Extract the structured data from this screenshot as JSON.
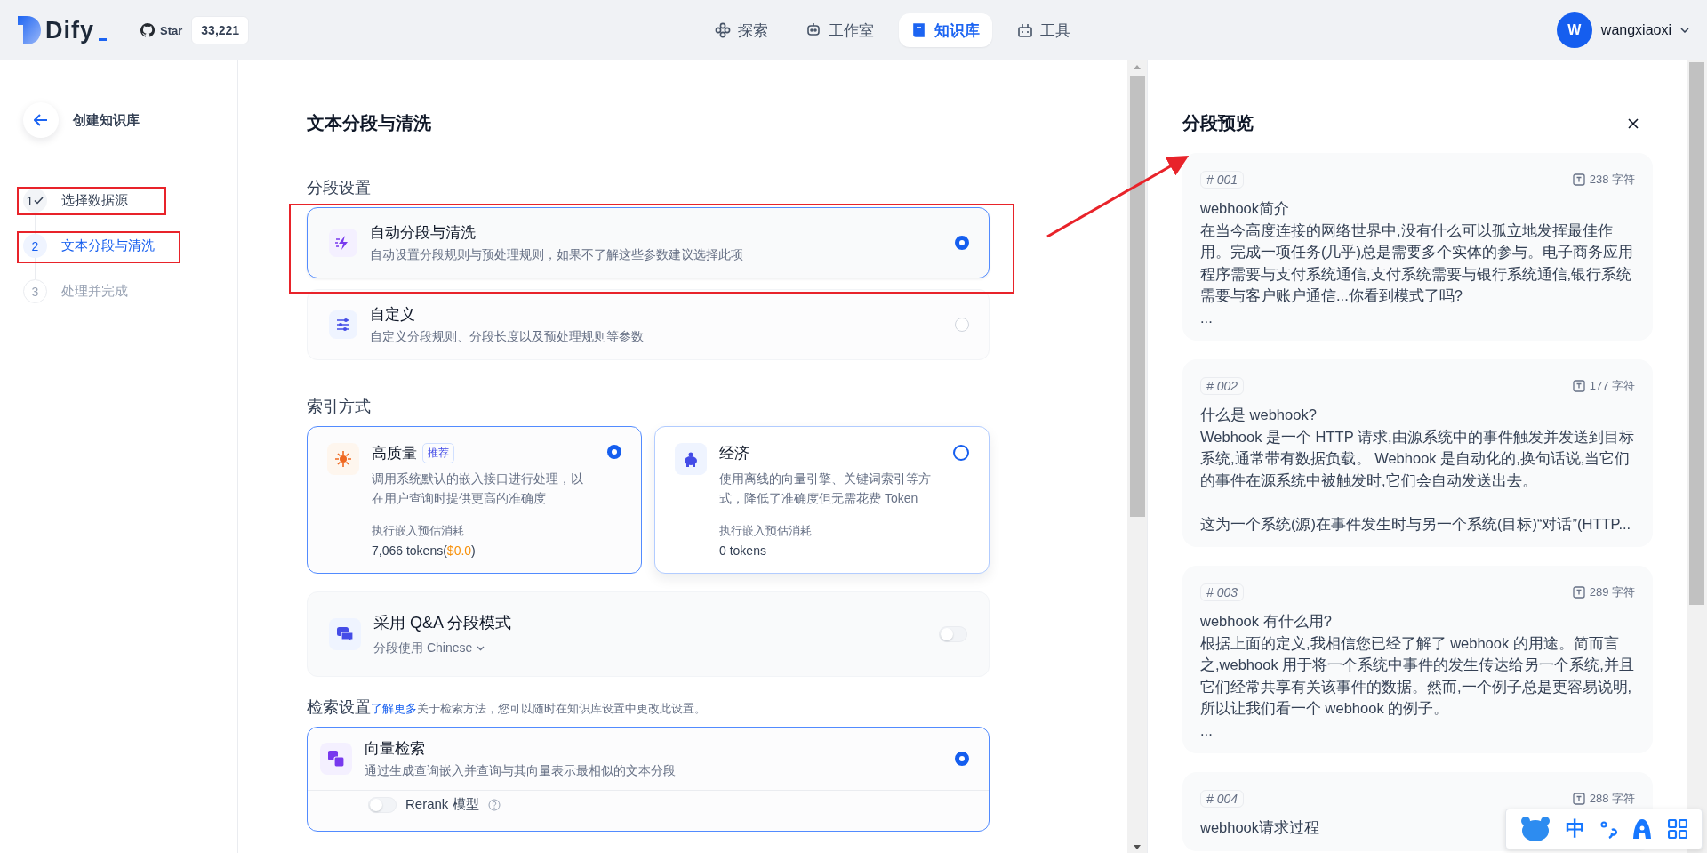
{
  "header": {
    "logo": "Dify",
    "github": {
      "label": "Star",
      "count": "33,221"
    },
    "nav": [
      {
        "label": "探索",
        "selected": false
      },
      {
        "label": "工作室",
        "selected": false
      },
      {
        "label": "知识库",
        "selected": true
      },
      {
        "label": "工具",
        "selected": false
      }
    ],
    "user": {
      "initial": "W",
      "name": "wangxiaoxi"
    }
  },
  "sidebar": {
    "title": "创建知识库",
    "steps": [
      {
        "number": "1",
        "label": "选择数据源",
        "done": true,
        "current": false
      },
      {
        "number": "2",
        "label": "文本分段与清洗",
        "done": false,
        "current": true
      },
      {
        "number": "3",
        "label": "处理并完成",
        "done": false,
        "current": false
      }
    ]
  },
  "main": {
    "title": "文本分段与清洗",
    "segment": {
      "heading": "分段设置",
      "options": [
        {
          "title": "自动分段与清洗",
          "description": "自动设置分段规则与预处理规则，如果不了解这些参数建议选择此项",
          "selected": true
        },
        {
          "title": "自定义",
          "description": "自定义分段规则、分段长度以及预处理规则等参数",
          "selected": false
        }
      ]
    },
    "index": {
      "heading": "索引方式",
      "options": [
        {
          "title": "高质量",
          "badge": "推荐",
          "description": "调用系统默认的嵌入接口进行处理，以在用户查询时提供更高的准确度",
          "cost_label": "执行嵌入预估消耗",
          "cost": [
            {
              "text": "7,066 tokens(",
              "kind": "plain"
            },
            {
              "text": "$0.0",
              "kind": "price"
            },
            {
              "text": ")",
              "kind": "plain"
            }
          ],
          "selected": true,
          "hovered": false
        },
        {
          "title": "经济",
          "description": "使用离线的向量引擎、关键词索引等方式，降低了准确度但无需花费 Token",
          "cost_label": "执行嵌入预估消耗",
          "cost": [
            {
              "text": "0 tokens",
              "kind": "plain"
            }
          ],
          "selected": false,
          "hovered": true
        }
      ]
    },
    "qa": {
      "title": "采用 Q&A 分段模式",
      "language": "分段使用 Chinese",
      "on": false
    },
    "retrieval": {
      "heading": "检索设置",
      "link": "了解更多",
      "note": "关于检索方法，您可以随时在知识库设置中更改此设置。",
      "option": {
        "title": "向量检索",
        "description": "通过生成查询嵌入并查询与其向量表示最相似的文本分段",
        "selected": true
      },
      "rerank": {
        "label": "Rerank 模型",
        "on": false
      }
    }
  },
  "preview": {
    "title": "分段预览",
    "segments": [
      {
        "id": "# 001",
        "count": "238 字符",
        "paragraphs": [
          {
            "text": "webhook简介",
            "spaced": false
          },
          {
            "text": "在当今高度连接的网络世界中,没有什么可以孤立地发挥最佳作用。完成一项任务(几乎)总是需要多个实体的参与。电子商务应用程序需要与支付系统通信,支付系统需要与银行系统通信,银行系统需要与客户账户通信...你看到模式了吗?",
            "spaced": false
          },
          {
            "text": "...",
            "spaced": false
          }
        ]
      },
      {
        "id": "# 002",
        "count": "177 字符",
        "paragraphs": [
          {
            "text": "什么是 webhook?",
            "spaced": false
          },
          {
            "text": "Webhook 是一个 HTTP 请求,由源系统中的事件触发并发送到目标系统,通常带有数据负载。 Webhook 是自动化的,换句话说,当它们的事件在源系统中被触发时,它们会自动发送出去。",
            "spaced": false
          },
          {
            "text": "这为一个系统(源)在事件发生时与另一个系统(目标)“对话”(HTTP...",
            "spaced": true
          }
        ]
      },
      {
        "id": "# 003",
        "count": "289 字符",
        "paragraphs": [
          {
            "text": "webhook 有什么用?",
            "spaced": false
          },
          {
            "text": "根据上面的定义,我相信您已经了解了 webhook 的用途。简而言之,webhook 用于将一个系统中事件的发生传达给另一个系统,并且它们经常共享有关该事件的数据。然而,一个例子总是更容易说明,所以让我们看一个 webhook 的例子。",
            "spaced": false
          },
          {
            "text": "...",
            "spaced": false
          }
        ]
      },
      {
        "id": "# 004",
        "count": "288 字符",
        "paragraphs": [
          {
            "text": "webhook请求过程",
            "spaced": false
          }
        ]
      }
    ]
  },
  "ime": {
    "mode": "中"
  }
}
